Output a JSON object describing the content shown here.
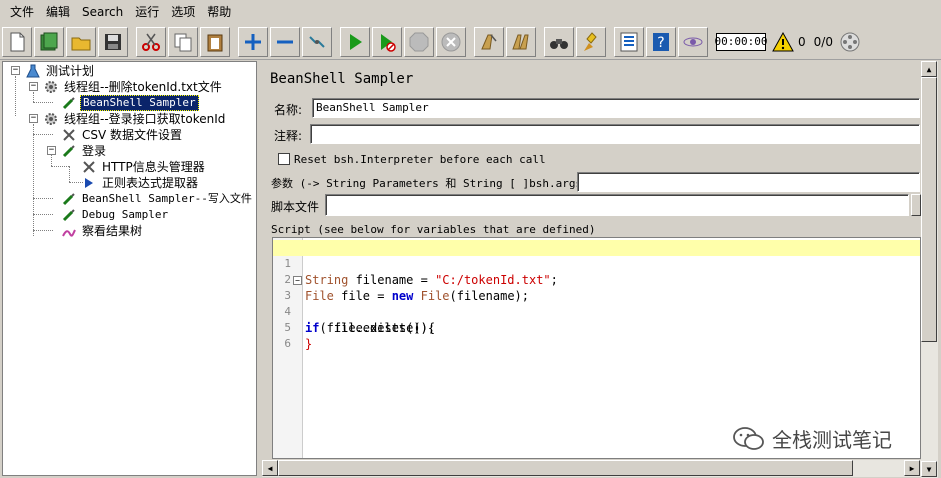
{
  "menu": [
    "文件",
    "编辑",
    "Search",
    "运行",
    "选项",
    "帮助"
  ],
  "toolbar": {
    "timer": "00:00:00",
    "warning_count": "0",
    "thread_count": "0/0",
    "icons": [
      "new-icon",
      "templates-icon",
      "open-icon",
      "save-icon",
      "cut-icon",
      "copy-icon",
      "paste-icon",
      "expand-icon",
      "collapse-icon",
      "toggle-icon",
      "start-icon",
      "start-no-pause-icon",
      "stop-icon",
      "shutdown-icon",
      "clear-icon",
      "clear-all-icon",
      "search-icon",
      "reset-search-icon",
      "function-helper-icon",
      "help-icon",
      "remote-icon"
    ]
  },
  "tree": {
    "test_plan": "测试计划",
    "thread_group_1": "线程组--删除tokenId.txt文件",
    "beanshell_sampler_1": "BeanShell Sampler",
    "thread_group_2": "线程组--登录接口获取tokenId",
    "csv_config": "CSV 数据文件设置",
    "login": "登录",
    "http_header": "HTTP信息头管理器",
    "regex_extractor": "正则表达式提取器",
    "beanshell_sampler_2": "BeanShell Sampler--写入文件",
    "debug_sampler": "Debug Sampler",
    "result_tree": "察看结果树"
  },
  "panel": {
    "title": "BeanShell Sampler",
    "name_label": "名称:",
    "name_value": "BeanShell Sampler",
    "comment_label": "注释:",
    "comment_value": "",
    "reset_checkbox_label": "Reset bsh.Interpreter before each call",
    "params_label": "参数 (-> String Parameters 和 String [ ]bsh.args)",
    "params_value": "",
    "script_file_label": "脚本文件",
    "script_file_value": "",
    "script_label": "Script (see below for variables that are defined)"
  },
  "script_lines": [
    {
      "n": "1"
    },
    {
      "n": "2"
    },
    {
      "n": "3"
    },
    {
      "n": "4"
    },
    {
      "n": "5"
    },
    {
      "n": "6"
    }
  ],
  "script_tokens": {
    "l1_type": "String",
    "l1_rest": " filename = ",
    "l1_str": "\"C:/tokenId.txt\"",
    "l1_end": ";",
    "l2_type": "File",
    "l2_a": " file = ",
    "l2_new": "new",
    "l2_cls": " File",
    "l2_end": "(filename);",
    "l3_if": "if",
    "l3_rest": "(file.exists()){",
    "l4": "    file.delete();",
    "l5": "}"
  },
  "watermark": "全栈测试笔记"
}
